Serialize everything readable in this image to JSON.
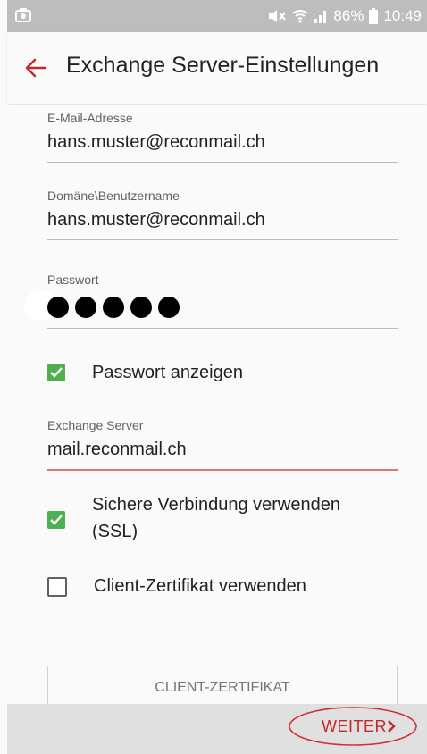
{
  "status_bar": {
    "battery": "86%",
    "time": "10:49"
  },
  "app_bar": {
    "title": "Exchange Server-Einstellungen"
  },
  "form": {
    "email": {
      "label": "E-Mail-Adresse",
      "value": "hans.muster@reconmail.ch"
    },
    "username": {
      "label": "Domäne\\Benutzername",
      "value": "hans.muster@reconmail.ch"
    },
    "password": {
      "label": "Passwort",
      "masked_char_count": 5
    },
    "show_password": {
      "label": "Passwort anzeigen",
      "checked": true
    },
    "server": {
      "label": "Exchange Server",
      "value": "mail.reconmail.ch"
    },
    "ssl": {
      "label_line1": "Sichere Verbindung verwenden",
      "label_line2": "(SSL)",
      "checked": true
    },
    "client_cert": {
      "label": "Client-Zertifikat verwenden",
      "checked": false
    },
    "client_cert_button": "CLIENT-ZERTIFIKAT"
  },
  "bottom_bar": {
    "next_label": "WEITER"
  },
  "colors": {
    "accent_red": "#c62828",
    "checkbox_green": "#4caf50",
    "status_bar": "#bdbdbd"
  }
}
